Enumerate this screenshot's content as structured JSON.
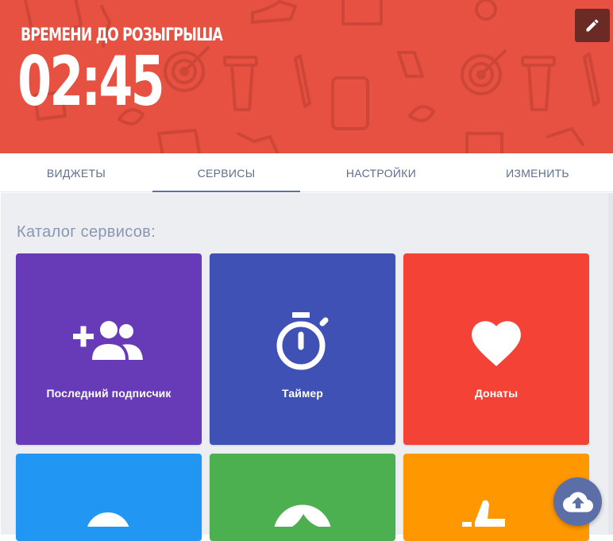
{
  "header": {
    "countdown_label": "ВРЕМЕНИ ДО РОЗЫГРЫША",
    "countdown_value": "02:45",
    "background_color": "#e75141",
    "edit_icon": "pencil-icon"
  },
  "tabs": [
    {
      "label": "ВИДЖЕТЫ",
      "active": false
    },
    {
      "label": "СЕРВИСЫ",
      "active": true
    },
    {
      "label": "НАСТРОЙКИ",
      "active": false
    },
    {
      "label": "ИЗМЕНИТЬ",
      "active": false
    }
  ],
  "catalog": {
    "title": "Каталог сервисов:",
    "cards": [
      {
        "label": "Последний подписчик",
        "icon": "add-group-icon",
        "color": "#673ab7"
      },
      {
        "label": "Таймер",
        "icon": "stopwatch-icon",
        "color": "#3f51b5"
      },
      {
        "label": "Донаты",
        "icon": "heart-icon",
        "color": "#f44336"
      },
      {
        "label": "",
        "icon": "cloud-icon",
        "color": "#2196f3"
      },
      {
        "label": "",
        "icon": "face-icon",
        "color": "#4caf50"
      },
      {
        "label": "",
        "icon": "thumbs-up-icon",
        "color": "#ff9800"
      }
    ]
  },
  "fab": {
    "icon": "cloud-upload-icon",
    "color": "#5c6ea7"
  }
}
